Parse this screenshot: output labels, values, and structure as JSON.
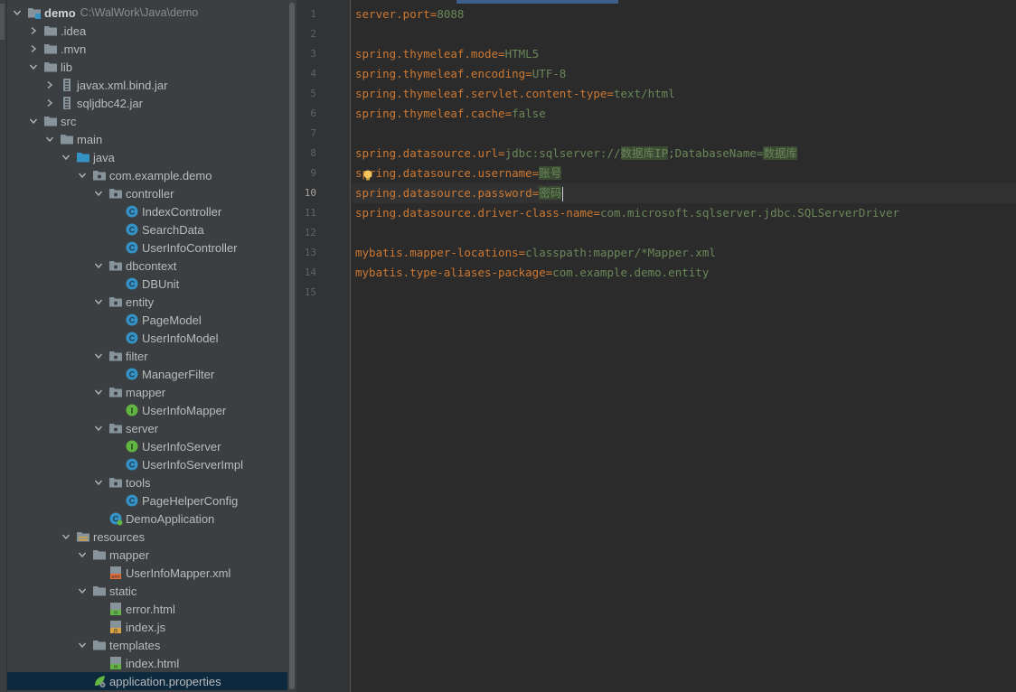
{
  "project": {
    "name": "demo",
    "path": "C:\\WalWork\\Java\\demo"
  },
  "tree": [
    {
      "label": "demo",
      "depth": 0,
      "arrow": "down",
      "icon": "module-folder-icon",
      "bold": true,
      "path": "C:\\WalWork\\Java\\demo"
    },
    {
      "label": ".idea",
      "depth": 1,
      "arrow": "right",
      "icon": "folder-icon"
    },
    {
      "label": ".mvn",
      "depth": 1,
      "arrow": "right",
      "icon": "folder-icon"
    },
    {
      "label": "lib",
      "depth": 1,
      "arrow": "down",
      "icon": "folder-icon"
    },
    {
      "label": "javax.xml.bind.jar",
      "depth": 2,
      "arrow": "right",
      "icon": "jar-icon"
    },
    {
      "label": "sqljdbc42.jar",
      "depth": 2,
      "arrow": "right",
      "icon": "jar-icon"
    },
    {
      "label": "src",
      "depth": 1,
      "arrow": "down",
      "icon": "folder-icon"
    },
    {
      "label": "main",
      "depth": 2,
      "arrow": "down",
      "icon": "folder-icon"
    },
    {
      "label": "java",
      "depth": 3,
      "arrow": "down",
      "icon": "source-folder-icon"
    },
    {
      "label": "com.example.demo",
      "depth": 4,
      "arrow": "down",
      "icon": "package-icon"
    },
    {
      "label": "controller",
      "depth": 5,
      "arrow": "down",
      "icon": "package-icon"
    },
    {
      "label": "IndexController",
      "depth": 6,
      "arrow": "none",
      "icon": "class-icon"
    },
    {
      "label": "SearchData",
      "depth": 6,
      "arrow": "none",
      "icon": "class-icon"
    },
    {
      "label": "UserInfoController",
      "depth": 6,
      "arrow": "none",
      "icon": "class-icon"
    },
    {
      "label": "dbcontext",
      "depth": 5,
      "arrow": "down",
      "icon": "package-icon"
    },
    {
      "label": "DBUnit",
      "depth": 6,
      "arrow": "none",
      "icon": "class-icon"
    },
    {
      "label": "entity",
      "depth": 5,
      "arrow": "down",
      "icon": "package-icon"
    },
    {
      "label": "PageModel",
      "depth": 6,
      "arrow": "none",
      "icon": "class-icon"
    },
    {
      "label": "UserInfoModel",
      "depth": 6,
      "arrow": "none",
      "icon": "class-icon"
    },
    {
      "label": "filter",
      "depth": 5,
      "arrow": "down",
      "icon": "package-icon"
    },
    {
      "label": "ManagerFilter",
      "depth": 6,
      "arrow": "none",
      "icon": "class-icon"
    },
    {
      "label": "mapper",
      "depth": 5,
      "arrow": "down",
      "icon": "package-icon"
    },
    {
      "label": "UserInfoMapper",
      "depth": 6,
      "arrow": "none",
      "icon": "interface-icon"
    },
    {
      "label": "server",
      "depth": 5,
      "arrow": "down",
      "icon": "package-icon"
    },
    {
      "label": "UserInfoServer",
      "depth": 6,
      "arrow": "none",
      "icon": "interface-icon"
    },
    {
      "label": "UserInfoServerImpl",
      "depth": 6,
      "arrow": "none",
      "icon": "class-icon"
    },
    {
      "label": "tools",
      "depth": 5,
      "arrow": "down",
      "icon": "package-icon"
    },
    {
      "label": "PageHelperConfig",
      "depth": 6,
      "arrow": "none",
      "icon": "class-icon"
    },
    {
      "label": "DemoApplication",
      "depth": 5,
      "arrow": "none",
      "icon": "spring-class-icon"
    },
    {
      "label": "resources",
      "depth": 3,
      "arrow": "down",
      "icon": "resources-folder-icon"
    },
    {
      "label": "mapper",
      "depth": 4,
      "arrow": "down",
      "icon": "folder-icon"
    },
    {
      "label": "UserInfoMapper.xml",
      "depth": 5,
      "arrow": "none",
      "icon": "xml-file-icon"
    },
    {
      "label": "static",
      "depth": 4,
      "arrow": "down",
      "icon": "folder-icon"
    },
    {
      "label": "error.html",
      "depth": 5,
      "arrow": "none",
      "icon": "html-file-icon"
    },
    {
      "label": "index.js",
      "depth": 5,
      "arrow": "none",
      "icon": "js-file-icon"
    },
    {
      "label": "templates",
      "depth": 4,
      "arrow": "down",
      "icon": "folder-icon"
    },
    {
      "label": "index.html",
      "depth": 5,
      "arrow": "none",
      "icon": "html-file-icon"
    },
    {
      "label": "application.properties",
      "depth": 4,
      "arrow": "none",
      "icon": "spring-properties-icon",
      "selected": true
    }
  ],
  "editor": {
    "current_line": 10,
    "lines": [
      {
        "n": "1",
        "tokens": [
          {
            "t": "k",
            "s": "server.port"
          },
          {
            "t": "e",
            "s": "="
          },
          {
            "t": "v",
            "s": "8088"
          }
        ]
      },
      {
        "n": "2",
        "tokens": []
      },
      {
        "n": "3",
        "tokens": [
          {
            "t": "k",
            "s": "spring.thymeleaf.mode"
          },
          {
            "t": "e",
            "s": "="
          },
          {
            "t": "v",
            "s": "HTML5"
          }
        ]
      },
      {
        "n": "4",
        "tokens": [
          {
            "t": "k",
            "s": "spring.thymeleaf.encoding"
          },
          {
            "t": "e",
            "s": "="
          },
          {
            "t": "v",
            "s": "UTF-8"
          }
        ]
      },
      {
        "n": "5",
        "tokens": [
          {
            "t": "k",
            "s": "spring.thymeleaf.servlet.content-type"
          },
          {
            "t": "e",
            "s": "="
          },
          {
            "t": "v",
            "s": "text/html"
          }
        ]
      },
      {
        "n": "6",
        "tokens": [
          {
            "t": "k",
            "s": "spring.thymeleaf.cache"
          },
          {
            "t": "e",
            "s": "="
          },
          {
            "t": "v",
            "s": "false"
          }
        ]
      },
      {
        "n": "7",
        "tokens": []
      },
      {
        "n": "8",
        "tokens": [
          {
            "t": "k",
            "s": "spring.datasource.url"
          },
          {
            "t": "e",
            "s": "="
          },
          {
            "t": "v",
            "s": "jdbc:sqlserver://"
          },
          {
            "t": "ph",
            "s": "数据库IP"
          },
          {
            "t": "v",
            "s": ";DatabaseName="
          },
          {
            "t": "ph",
            "s": "数据库"
          }
        ]
      },
      {
        "n": "9",
        "tokens": [
          {
            "t": "k",
            "s": "spring.datasource.username"
          },
          {
            "t": "e",
            "s": "="
          },
          {
            "t": "ph",
            "s": "账号"
          }
        ]
      },
      {
        "n": "10",
        "tokens": [
          {
            "t": "k",
            "s": "spring.datasource.password"
          },
          {
            "t": "e",
            "s": "="
          },
          {
            "t": "ph",
            "s": "密码"
          }
        ],
        "caret": true
      },
      {
        "n": "11",
        "tokens": [
          {
            "t": "k",
            "s": "spring.datasource.driver-class-name"
          },
          {
            "t": "e",
            "s": "="
          },
          {
            "t": "v",
            "s": "com.microsoft.sqlserver.jdbc.SQLServerDriver"
          }
        ]
      },
      {
        "n": "12",
        "tokens": []
      },
      {
        "n": "13",
        "tokens": [
          {
            "t": "k",
            "s": "mybatis.mapper-locations"
          },
          {
            "t": "e",
            "s": "="
          },
          {
            "t": "v",
            "s": "classpath:mapper/*Mapper.xml"
          }
        ]
      },
      {
        "n": "14",
        "tokens": [
          {
            "t": "k",
            "s": "mybatis.type-aliases-package"
          },
          {
            "t": "e",
            "s": "="
          },
          {
            "t": "v",
            "s": "com.example.demo.entity"
          }
        ]
      },
      {
        "n": "15",
        "tokens": []
      }
    ]
  },
  "colors": {
    "key": "#cc7832",
    "value": "#6a8759",
    "selection": "#0d293e",
    "class_icon": "#3592c4",
    "interface_icon": "#62b543"
  }
}
